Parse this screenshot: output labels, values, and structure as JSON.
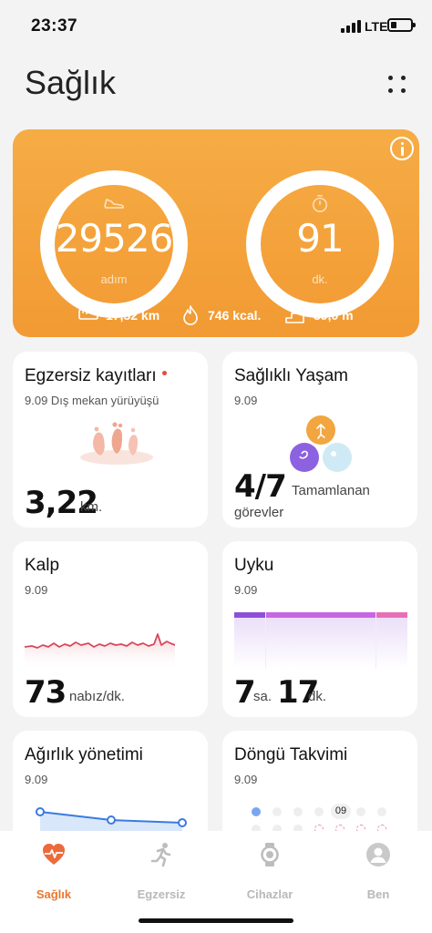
{
  "status_bar": {
    "time": "23:37",
    "network": "LTE"
  },
  "header": {
    "title": "Sağlık"
  },
  "summary": {
    "steps": {
      "value": "29526",
      "unit": "adım"
    },
    "minutes": {
      "value": "91",
      "unit": "dk."
    },
    "distance": "17,52 km",
    "calories": "746 kcal.",
    "floors": "39,0 m",
    "accent_color": "#f29a33"
  },
  "tiles": {
    "exercise": {
      "title": "Egzersiz kayıtları",
      "subtitle": "9.09 Dış mekan yürüyüşü",
      "value": "3,22",
      "unit": "km."
    },
    "healthy_living": {
      "title": "Sağlıklı Yaşam",
      "date": "9.09",
      "value": "4/7",
      "label_line1": "Tamamlanan",
      "label_line2": "görevler"
    },
    "heart": {
      "title": "Kalp",
      "date": "9.09",
      "value": "73",
      "unit": "nabız/dk."
    },
    "sleep": {
      "title": "Uyku",
      "date": "9.09",
      "hours": "7",
      "hours_unit": "sa.",
      "minutes": "17",
      "minutes_unit": "dk."
    },
    "weight": {
      "title": "Ağırlık yönetimi",
      "date": "9.09"
    },
    "cycle": {
      "title": "Döngü Takvimi",
      "date": "9.09",
      "today": "09"
    }
  },
  "bottom_nav": {
    "items": [
      {
        "label": "Sağlık",
        "icon": "heart-pulse-icon",
        "active": true
      },
      {
        "label": "Egzersiz",
        "icon": "running-icon",
        "active": false
      },
      {
        "label": "Cihazlar",
        "icon": "watch-icon",
        "active": false
      },
      {
        "label": "Ben",
        "icon": "profile-icon",
        "active": false
      }
    ],
    "active_color": "#e9762f"
  }
}
